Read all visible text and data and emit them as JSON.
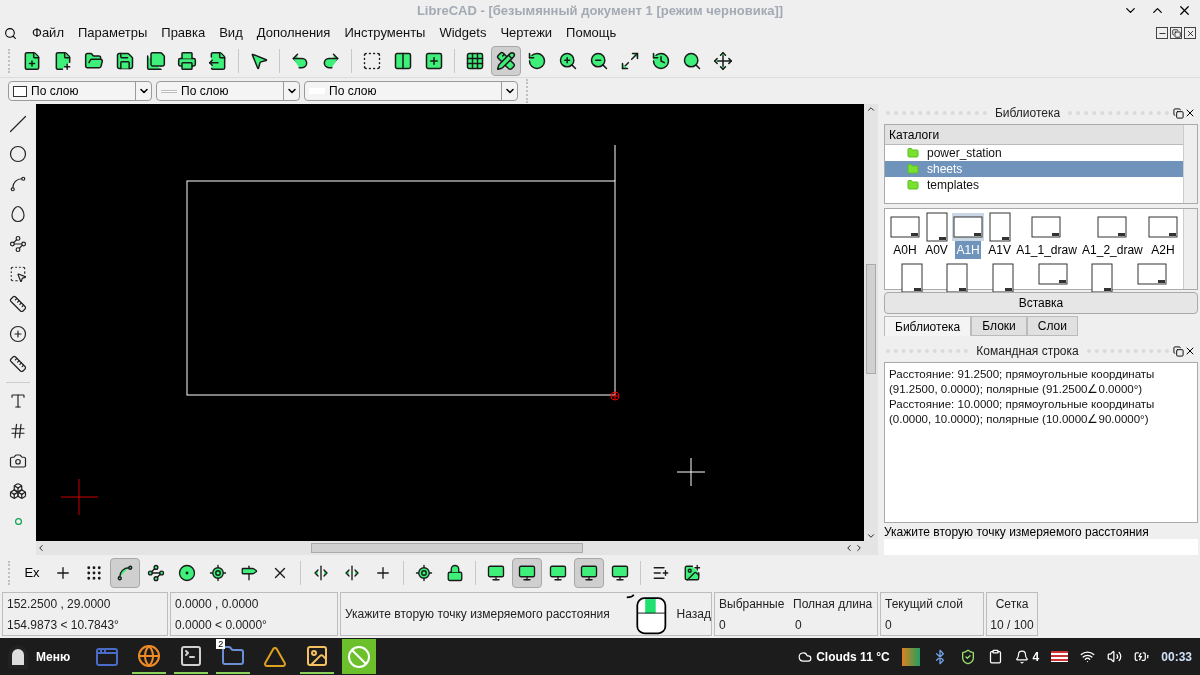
{
  "window": {
    "title": "LibreCAD - [безымянный документ 1 [режим черновика]]"
  },
  "menu": [
    "Файл",
    "Параметры",
    "Правка",
    "Вид",
    "Дополнения",
    "Инструменты",
    "Widgets",
    "Чертежи",
    "Помощь"
  ],
  "main_toolbar": [
    {
      "kind": "new",
      "selected": false
    },
    {
      "kind": "new-template",
      "selected": false
    },
    {
      "kind": "open",
      "selected": false
    },
    {
      "kind": "save",
      "selected": false
    },
    {
      "kind": "save-as",
      "selected": false
    },
    {
      "kind": "print",
      "selected": false
    },
    {
      "kind": "print-preview",
      "selected": false
    },
    {
      "kind": "sep"
    },
    {
      "kind": "select",
      "selected": false
    },
    {
      "kind": "sep"
    },
    {
      "kind": "undo",
      "selected": false
    },
    {
      "kind": "redo",
      "selected": false
    },
    {
      "kind": "sep"
    },
    {
      "kind": "select-window",
      "selected": false
    },
    {
      "kind": "columns",
      "selected": false
    },
    {
      "kind": "add-block",
      "selected": false
    },
    {
      "kind": "sep"
    },
    {
      "kind": "grid",
      "selected": false
    },
    {
      "kind": "draft",
      "selected": true
    },
    {
      "kind": "redraw",
      "selected": false
    },
    {
      "kind": "zoom-in",
      "selected": false
    },
    {
      "kind": "zoom-out",
      "selected": false
    },
    {
      "kind": "zoom-auto",
      "selected": false
    },
    {
      "kind": "zoom-previous",
      "selected": false
    },
    {
      "kind": "zoom-window",
      "selected": false
    },
    {
      "kind": "pan",
      "selected": false
    }
  ],
  "pen_toolbar": [
    {
      "kind": "color",
      "value": "По слою"
    },
    {
      "kind": "width",
      "value": "По слою"
    },
    {
      "kind": "linetype",
      "value": "По слою"
    }
  ],
  "tools": [
    {
      "kind": "line"
    },
    {
      "kind": "circle"
    },
    {
      "kind": "spline"
    },
    {
      "kind": "ellipse"
    },
    {
      "kind": "polyline"
    },
    {
      "kind": "select"
    },
    {
      "kind": "dimension"
    },
    {
      "kind": "modify"
    },
    {
      "kind": "measure"
    },
    {
      "kind": "sep"
    },
    {
      "kind": "text"
    },
    {
      "kind": "hatch"
    },
    {
      "kind": "image"
    },
    {
      "kind": "block"
    },
    {
      "kind": "point"
    }
  ],
  "library": {
    "title": "Библиотека",
    "tree_header": "Каталоги",
    "folders": [
      {
        "name": "power_station",
        "selected": false
      },
      {
        "name": "sheets",
        "selected": true
      },
      {
        "name": "templates",
        "selected": false
      }
    ],
    "thumbnails": [
      {
        "label": "A0H",
        "kind": "landscape",
        "selected": false
      },
      {
        "label": "A0V",
        "kind": "portrait",
        "selected": false
      },
      {
        "label": "A1H",
        "kind": "landscape",
        "selected": true
      },
      {
        "label": "A1V",
        "kind": "portrait",
        "selected": false
      },
      {
        "label": "A1_1_draw",
        "kind": "landscape",
        "selected": false
      },
      {
        "label": "A1_2_draw",
        "kind": "landscape",
        "selected": false
      },
      {
        "label": "A2H",
        "kind": "landscape",
        "selected": false
      }
    ],
    "thumbnails_row_2": [
      {
        "kind": "portrait"
      },
      {
        "kind": "portrait"
      },
      {
        "kind": "portrait"
      },
      {
        "kind": "landscape"
      },
      {
        "kind": "portrait"
      },
      {
        "kind": "landscape"
      }
    ],
    "insert_button": "Вставка"
  },
  "dock_tabs": [
    {
      "label": "Библиотека",
      "selected": true
    },
    {
      "label": "Блоки",
      "selected": false
    },
    {
      "label": "Слои",
      "selected": false
    }
  ],
  "command_line": {
    "title": "Командная строка",
    "log": [
      "Расстояние: 91.2500; прямоугольные координаты (91.2500, 0.0000); полярные (91.2500∠0.0000°)",
      "Расстояние: 10.0000; прямоугольные координаты (0.0000, 10.0000); полярные (10.0000∠90.0000°)"
    ],
    "prompt": "Укажите вторую точку измеряемого расстояния"
  },
  "snap_toolbar": [
    {
      "kind": "exclusive",
      "label": "Ex",
      "selected": false
    },
    {
      "kind": "free",
      "selected": false
    },
    {
      "kind": "grid",
      "selected": false
    },
    {
      "kind": "endpoint",
      "selected": true
    },
    {
      "kind": "on-entity",
      "selected": false
    },
    {
      "kind": "center",
      "selected": false
    },
    {
      "kind": "middle",
      "selected": false
    },
    {
      "kind": "distance",
      "selected": false
    },
    {
      "kind": "intersection",
      "selected": false
    },
    {
      "kind": "sep"
    },
    {
      "kind": "horizontal",
      "selected": false
    },
    {
      "kind": "vertical",
      "selected": false
    },
    {
      "kind": "orthogonal",
      "selected": false
    },
    {
      "kind": "sep"
    },
    {
      "kind": "relative-zero",
      "selected": false
    },
    {
      "kind": "lock",
      "selected": false
    },
    {
      "kind": "sep"
    },
    {
      "kind": "monitor",
      "selected": false
    },
    {
      "kind": "monitor",
      "selected": true
    },
    {
      "kind": "monitor",
      "selected": false
    },
    {
      "kind": "monitor",
      "selected": true
    },
    {
      "kind": "monitor",
      "selected": false
    },
    {
      "kind": "sep"
    },
    {
      "kind": "list-add",
      "selected": false
    },
    {
      "kind": "image-add",
      "selected": false
    }
  ],
  "status_bar": {
    "absolute": [
      "152.2500 , 29.0000",
      "154.9873 < 10.7843°"
    ],
    "relative": [
      "0.0000 , 0.0000",
      "0.0000 < 0.0000°"
    ],
    "message": "Укажите вторую точку измеряемого расстояния",
    "mouse_right": "Назад",
    "selected": {
      "label": "Выбранные",
      "value": "0"
    },
    "total_length": {
      "label": "Полная длина",
      "value": "0"
    },
    "current_layer": {
      "label": "Текущий слой",
      "value": "0"
    },
    "grid": {
      "label": "Сетка",
      "value": "10 / 100"
    }
  },
  "taskbar": {
    "menu": "Меню",
    "apps": [
      {
        "kind": "desktop",
        "running": false,
        "selected": false
      },
      {
        "kind": "browser",
        "running": true,
        "selected": false
      },
      {
        "kind": "terminal",
        "running": true,
        "selected": false
      },
      {
        "kind": "files",
        "running": true,
        "selected": false,
        "badge": "2"
      },
      {
        "kind": "colorful",
        "running": false,
        "selected": false
      },
      {
        "kind": "image-viewer",
        "running": true,
        "selected": false
      },
      {
        "kind": "cad",
        "running": false,
        "selected": true
      }
    ],
    "weather": "Clouds 11 °C",
    "notifications": "4",
    "clock": "00:33"
  }
}
